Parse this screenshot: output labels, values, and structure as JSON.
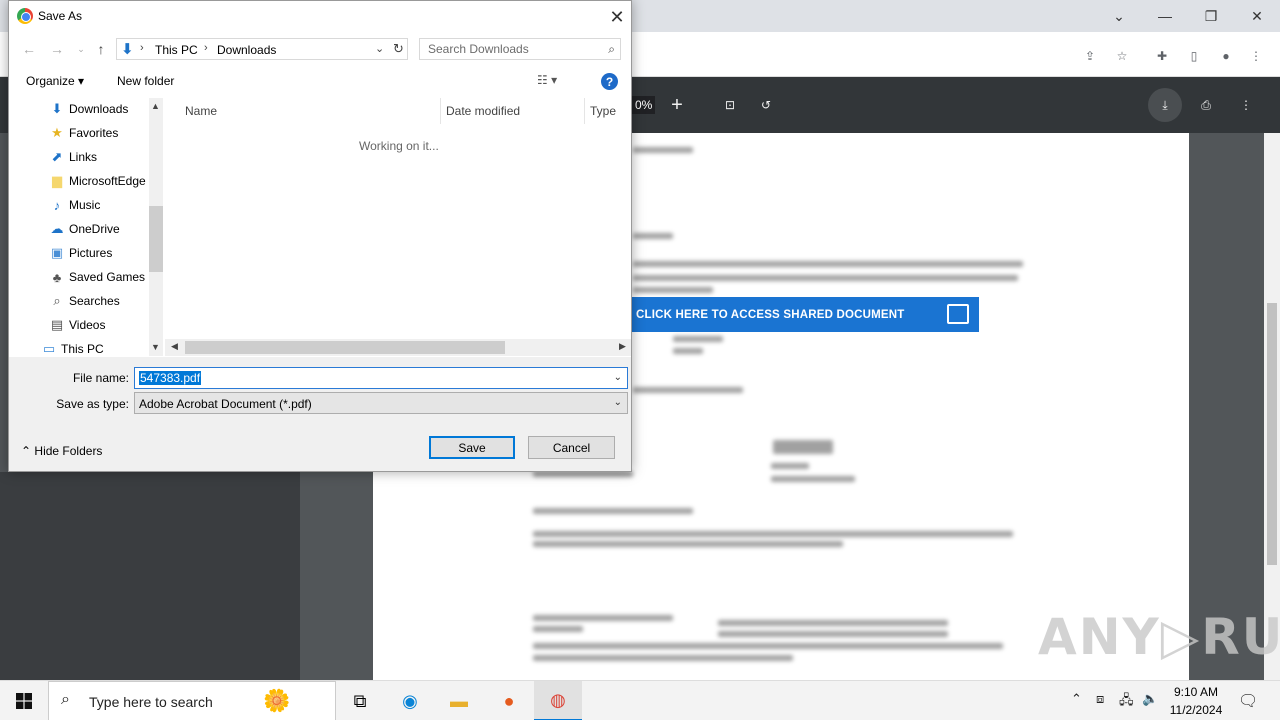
{
  "dialog": {
    "title": "Save As",
    "nav": {
      "path": [
        "This PC",
        "Downloads"
      ],
      "search_placeholder": "Search Downloads"
    },
    "commands": {
      "organize": "Organize ▾",
      "new_folder": "New folder",
      "help": "?"
    },
    "sidebar": {
      "items": [
        {
          "label": "Downloads",
          "icon": "download-icon"
        },
        {
          "label": "Favorites",
          "icon": "star-icon"
        },
        {
          "label": "Links",
          "icon": "link-icon"
        },
        {
          "label": "MicrosoftEdge",
          "icon": "folder-icon"
        },
        {
          "label": "Music",
          "icon": "music-icon"
        },
        {
          "label": "OneDrive",
          "icon": "cloud-icon"
        },
        {
          "label": "Pictures",
          "icon": "pictures-icon"
        },
        {
          "label": "Saved Games",
          "icon": "games-icon"
        },
        {
          "label": "Searches",
          "icon": "search-icon"
        },
        {
          "label": "Videos",
          "icon": "video-icon"
        },
        {
          "label": "This PC",
          "icon": "computer-icon"
        }
      ]
    },
    "columns": [
      "Name",
      "Date modified",
      "Type"
    ],
    "status": "Working on it...",
    "filename_label": "File name:",
    "filename_value": "547383.pdf",
    "savetype_label": "Save as type:",
    "savetype_value": "Adobe Acrobat Document (*.pdf)",
    "hide_folders": "Hide Folders",
    "save_label": "Save",
    "cancel_label": "Cancel"
  },
  "pdf_viewer": {
    "zoom": "0%",
    "banner_text": "CLICK HERE TO ACCESS SHARED DOCUMENT",
    "watermark": "ANY▷RUN"
  },
  "taskbar": {
    "search_text": "Type here to search",
    "time": "9:10 AM",
    "date": "11/2/2024"
  },
  "colors": {
    "accent": "#0078d7",
    "banner": "#1a74d2",
    "pdf_toolbar": "#323639",
    "pdf_background": "#525659"
  }
}
